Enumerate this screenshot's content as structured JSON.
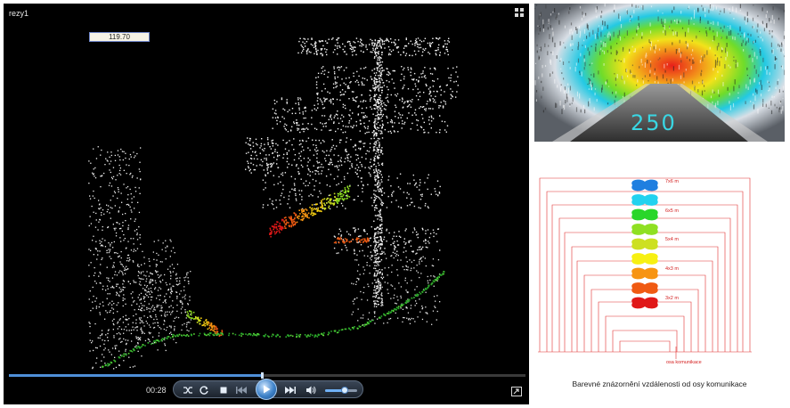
{
  "player": {
    "window_title": "rezy1",
    "distance_value": "119.70",
    "time": "00:28",
    "progress": 0.49,
    "volume": 0.6,
    "icons": {
      "fullscreen": "fullscreen-icon",
      "shuffle": "shuffle-icon",
      "repeat": "repeat-icon",
      "stop": "stop-icon",
      "previous": "previous-icon",
      "play": "play-icon",
      "next": "next-icon",
      "volume": "volume-icon",
      "switch_view": "switch-view-icon"
    },
    "colors": {
      "progress": "#4f8fd8",
      "background": "#000000"
    }
  },
  "photo": {
    "label": "250"
  },
  "diagram": {
    "labels": [
      "7x6 m",
      "6x5 m",
      "5x4 m",
      "4x3 m",
      "3x2 m"
    ],
    "axis_label": "osa komunikace",
    "blob_colors": [
      "#1f7fe0",
      "#22d2ef",
      "#2ad62a",
      "#8fe022",
      "#cde022",
      "#f7f012",
      "#f79412",
      "#f05a12",
      "#e01818"
    ],
    "line_color": "#e03030"
  },
  "caption": "Barevné znázornění vzdálenosti od osy komunikace"
}
